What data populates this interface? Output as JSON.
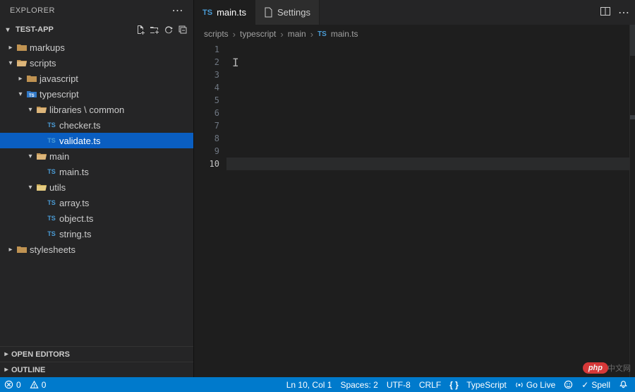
{
  "explorer": {
    "title": "EXPLORER",
    "project": "TEST-APP",
    "toolbar_icons": [
      "new-file-icon",
      "new-folder-icon",
      "refresh-icon",
      "collapse-all-icon"
    ],
    "tree": [
      {
        "type": "folder",
        "name": "markups",
        "depth": 0,
        "expanded": false
      },
      {
        "type": "folder",
        "name": "scripts",
        "depth": 0,
        "expanded": true,
        "special": "scripts"
      },
      {
        "type": "folder",
        "name": "javascript",
        "depth": 1,
        "expanded": false
      },
      {
        "type": "folder",
        "name": "typescript",
        "depth": 1,
        "expanded": true,
        "special": "ts-folder"
      },
      {
        "type": "folder",
        "name": "libraries \\ common",
        "depth": 2,
        "expanded": true
      },
      {
        "type": "file",
        "name": "checker.ts",
        "depth": 3,
        "lang": "ts"
      },
      {
        "type": "file",
        "name": "validate.ts",
        "depth": 3,
        "lang": "ts",
        "selected": true
      },
      {
        "type": "folder",
        "name": "main",
        "depth": 2,
        "expanded": true
      },
      {
        "type": "file",
        "name": "main.ts",
        "depth": 3,
        "lang": "ts"
      },
      {
        "type": "folder",
        "name": "utils",
        "depth": 2,
        "expanded": true,
        "special": "utils"
      },
      {
        "type": "file",
        "name": "array.ts",
        "depth": 3,
        "lang": "ts"
      },
      {
        "type": "file",
        "name": "object.ts",
        "depth": 3,
        "lang": "ts"
      },
      {
        "type": "file",
        "name": "string.ts",
        "depth": 3,
        "lang": "ts"
      },
      {
        "type": "folder",
        "name": "stylesheets",
        "depth": 0,
        "expanded": false
      }
    ],
    "bottom_sections": [
      "OPEN EDITORS",
      "OUTLINE"
    ]
  },
  "editor": {
    "tabs": [
      {
        "label": "main.ts",
        "icon": "ts",
        "active": true
      },
      {
        "label": "Settings",
        "icon": "doc",
        "active": false
      }
    ],
    "breadcrumbs": [
      "scripts",
      "typescript",
      "main",
      "main.ts"
    ],
    "line_numbers": [
      1,
      2,
      3,
      4,
      5,
      6,
      7,
      8,
      9,
      10
    ],
    "active_line": 10,
    "cursor_line": 2
  },
  "status": {
    "left": {
      "errors": "0",
      "warnings": "0"
    },
    "right": {
      "position": "Ln 10, Col 1",
      "spaces": "Spaces: 2",
      "encoding": "UTF-8",
      "eol": "CRLF",
      "language": "TypeScript",
      "golive": "Go Live",
      "spell": "Spell"
    }
  },
  "watermark": {
    "badge": "php",
    "text": "中文网"
  }
}
